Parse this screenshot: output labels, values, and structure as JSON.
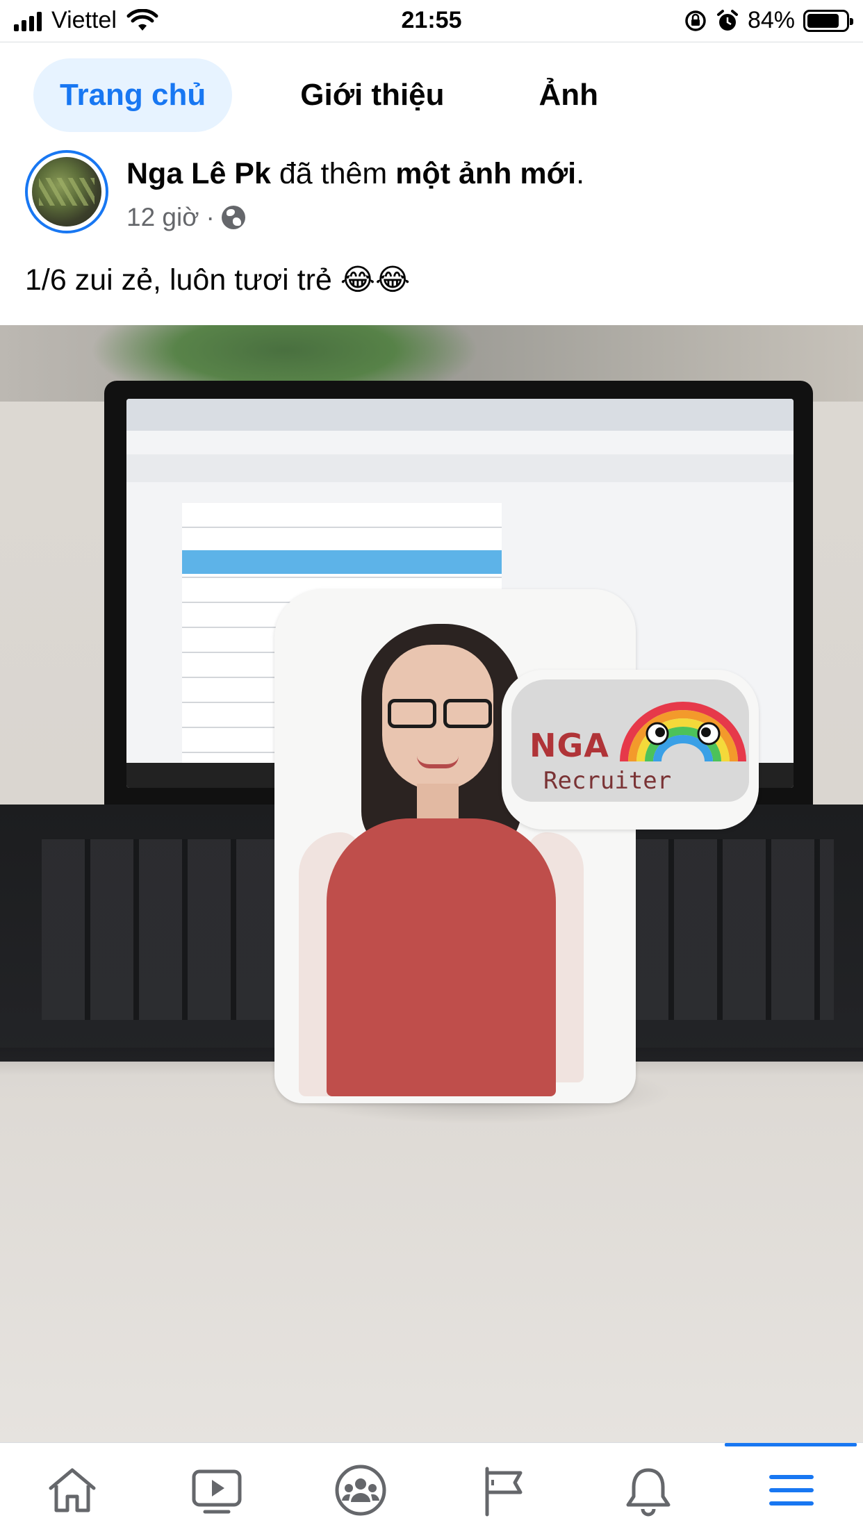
{
  "status_bar": {
    "carrier": "Viettel",
    "time": "21:55",
    "battery": "84%",
    "battery_level": 0.84
  },
  "profile_tabs": [
    {
      "label": "Trang chủ",
      "active": true
    },
    {
      "label": "Giới thiệu",
      "active": false
    },
    {
      "label": "Ảnh",
      "active": false
    }
  ],
  "post": {
    "author": "Nga Lê Pk",
    "action": "đã thêm",
    "object": "một ảnh mới",
    "period": ".",
    "time": "12 giờ",
    "separator": "·",
    "privacy_icon": "globe-icon",
    "caption": "1/6 zui zẻ, luôn tươi trẻ 😂😂"
  },
  "photo": {
    "bubble_name": "NGA",
    "bubble_role": "Recruiter"
  },
  "bottom_nav": [
    {
      "icon": "home-icon"
    },
    {
      "icon": "video-icon"
    },
    {
      "icon": "groups-icon"
    },
    {
      "icon": "pages-flag-icon"
    },
    {
      "icon": "bell-icon"
    },
    {
      "icon": "menu-icon",
      "active": true
    }
  ],
  "colors": {
    "accent": "#1877f2",
    "tab_active_bg": "#e7f3ff",
    "secondary_text": "#65676b"
  }
}
